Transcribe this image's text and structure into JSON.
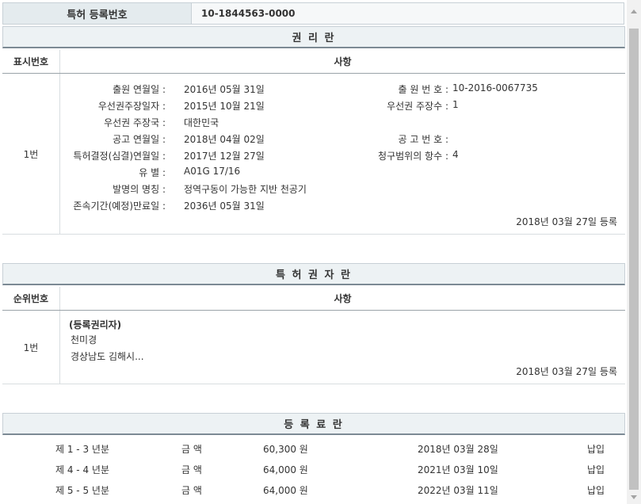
{
  "header": {
    "label": "특허 등록번호",
    "value": "10-1844563-0000"
  },
  "rights": {
    "title": "권 리 란",
    "col_num": "표시번호",
    "col_item": "사항",
    "row_num": "1번",
    "left_fields": [
      {
        "label": "출원 연월일 :",
        "value": "2016년 05월 31일"
      },
      {
        "label": "우선권주장일자 :",
        "value": "2015년 10월 21일"
      },
      {
        "label": "우선권 주장국 :",
        "value": "대한민국"
      },
      {
        "label": "공고 연월일 :",
        "value": "2018년 04월 02일"
      },
      {
        "label": "특허결정(심결)연월일 :",
        "value": "2017년 12월 27일"
      },
      {
        "label": "유 별 :",
        "value": "A01G 17/16"
      },
      {
        "label": "발명의 명칭 :",
        "value": "정역구동이 가능한 지반 천공기"
      },
      {
        "label": "존속기간(예정)만료일 :",
        "value": "2036년 05월 31일"
      }
    ],
    "right_fields": [
      {
        "label": "출 원 번 호 :",
        "value": "10-2016-0067735"
      },
      {
        "label": "우선권 주장수 :",
        "value": "1"
      },
      {
        "label": "공 고 번 호 :",
        "value": ""
      },
      {
        "label": "청구범위의 항수 :",
        "value": "4"
      }
    ],
    "reg_date": "2018년 03월 27일 등록"
  },
  "holders": {
    "title": "특 허 권 자 란",
    "col_num": "순위번호",
    "col_item": "사항",
    "row_num": "1번",
    "type": "(등록권리자)",
    "name": "천미경",
    "address": "경상남도 김해시...",
    "reg_date": "2018년 03월 27일 등록"
  },
  "fees": {
    "title": "등 록 료 란",
    "rows": [
      {
        "period": "제 1 - 3 년분",
        "amount_label": "금 액",
        "amount": "60,300 원",
        "date": "2018년 03월 28일",
        "status": "납입"
      },
      {
        "period": "제 4 - 4 년분",
        "amount_label": "금 액",
        "amount": "64,000 원",
        "date": "2021년 03월 10일",
        "status": "납입"
      },
      {
        "period": "제 5 - 5 년분",
        "amount_label": "금 액",
        "amount": "64,000 원",
        "date": "2022년 03월 11일",
        "status": "납입"
      }
    ]
  }
}
